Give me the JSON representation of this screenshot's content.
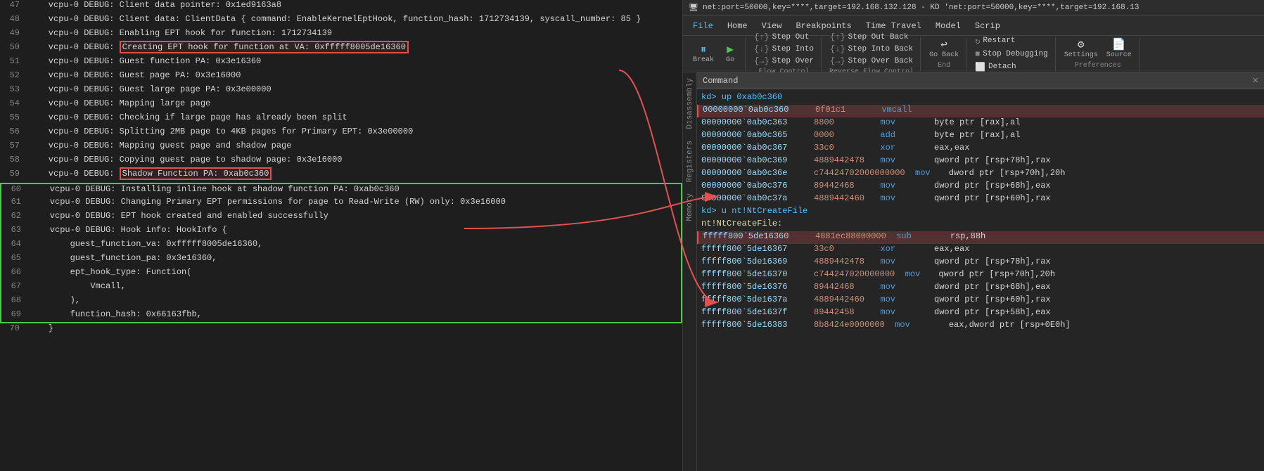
{
  "title": "net:port=50000,key=****,target=192.168.132.128 - KD 'net:port=50000,key=****,target=192.168.13",
  "menu": {
    "items": [
      "File",
      "Home",
      "View",
      "Breakpoints",
      "Time Travel",
      "Model",
      "Scrip"
    ]
  },
  "toolbar": {
    "break_label": "Break",
    "go_label": "Go",
    "step_out_label": "Step Out",
    "step_into_label": "Step Into",
    "step_over_label": "Step Over",
    "step_out_back_label": "Step Out Back",
    "step_into_back_label": "Step Into Back",
    "step_over_back_label": "Step Over Back",
    "go_back_label": "Go Back",
    "restart_label": "Restart",
    "stop_label": "Stop Debugging",
    "detach_label": "Detach",
    "settings_label": "Settings",
    "source_label": "Source",
    "flow_control": "Flow Control",
    "reverse_flow": "Reverse Flow Control",
    "end": "End",
    "preferences": "Preferences"
  },
  "side_tabs": [
    "Disassembly",
    "Registers",
    "Memory"
  ],
  "command_panel": {
    "title": "Command",
    "lines": [
      {
        "type": "prompt",
        "text": "kd> up 0xab0c360"
      },
      {
        "type": "asm",
        "addr": "00000000`0ab0c360",
        "bytes": "0f01c1",
        "instr": "vmcall",
        "operand": "",
        "highlight": "red"
      },
      {
        "type": "asm",
        "addr": "00000000`0ab0c363",
        "bytes": "8800",
        "instr": "mov",
        "operand": "     byte ptr [rax],al"
      },
      {
        "type": "asm",
        "addr": "00000000`0ab0c365",
        "bytes": "0000",
        "instr": "add",
        "operand": "     byte ptr [rax],al"
      },
      {
        "type": "asm",
        "addr": "00000000`0ab0c367",
        "bytes": "33c0",
        "instr": "xor",
        "operand": "     eax,eax"
      },
      {
        "type": "asm",
        "addr": "00000000`0ab0c369",
        "bytes": "4889442478",
        "instr": "mov",
        "operand": "     qword ptr [rsp+78h],rax"
      },
      {
        "type": "asm",
        "addr": "00000000`0ab0c36e",
        "bytes": "c74424702000000000",
        "instr": "mov",
        "operand": " dword ptr [rsp+70h],20h"
      },
      {
        "type": "asm",
        "addr": "00000000`0ab0c376",
        "bytes": "89442468",
        "instr": "mov",
        "operand": "     dword ptr [rsp+68h],eax"
      },
      {
        "type": "asm",
        "addr": "00000000`0ab0c37a",
        "bytes": "4889442460",
        "instr": "mov",
        "operand": "     qword ptr [rsp+60h],rax"
      },
      {
        "type": "prompt",
        "text": "kd> u nt!NtCreateFile"
      },
      {
        "type": "label",
        "text": "nt!NtCreateFile:"
      },
      {
        "type": "asm",
        "addr": "fffff800`5de16360",
        "bytes": "4881ec88000000",
        "instr": "sub",
        "operand": "     rsp,88h",
        "highlight": "red"
      },
      {
        "type": "asm",
        "addr": "fffff800`5de16367",
        "bytes": "33c0",
        "instr": "xor",
        "operand": "     eax,eax"
      },
      {
        "type": "asm",
        "addr": "fffff800`5de16369",
        "bytes": "4889442478",
        "instr": "mov",
        "operand": "     qword ptr [rsp+78h],rax"
      },
      {
        "type": "asm",
        "addr": "fffff800`5de16370",
        "bytes": "c744247020000000",
        "instr": "mov",
        "operand": " qword ptr [rsp+70h],20h"
      },
      {
        "type": "asm",
        "addr": "fffff800`5de16376",
        "bytes": "89442468",
        "instr": "mov",
        "operand": "     dword ptr [rsp+68h],eax"
      },
      {
        "type": "asm",
        "addr": "fffff800`5de1637a",
        "bytes": "4889442460",
        "instr": "mov",
        "operand": "     qword ptr [rsp+60h],rax"
      },
      {
        "type": "asm",
        "addr": "fffff800`5de1637f",
        "bytes": "89442458",
        "instr": "mov",
        "operand": "     dword ptr [rsp+58h],eax"
      },
      {
        "type": "asm",
        "addr": "fffff800`5de16383",
        "bytes": "8b8424e0000000",
        "instr": "mov",
        "operand": "     eax,dword ptr [rsp+0E0h]"
      }
    ]
  },
  "code_lines": [
    {
      "num": 47,
      "text": "    vcpu-0 DEBUG: Client data pointer: 0x1ed9163a8"
    },
    {
      "num": 48,
      "text": "    vcpu-0 DEBUG: Client data: ClientData { command: EnableKernelEptHook, function_hash: 1712734139, syscall_number: 85 }"
    },
    {
      "num": 49,
      "text": "    vcpu-0 DEBUG: Enabling EPT hook for function: 1712734139"
    },
    {
      "num": 50,
      "text": "    vcpu-0 DEBUG: Creating EPT hook for function at VA: 0xfffff8005de16360",
      "highlight_inline": "Creating EPT hook for function at VA: 0xfffff8005de16360"
    },
    {
      "num": 51,
      "text": "    vcpu-0 DEBUG: Guest function PA: 0x3e16360"
    },
    {
      "num": 52,
      "text": "    vcpu-0 DEBUG: Guest page PA: 0x3e16000"
    },
    {
      "num": 53,
      "text": "    vcpu-0 DEBUG: Guest large page PA: 0x3e00000"
    },
    {
      "num": 54,
      "text": "    vcpu-0 DEBUG: Mapping large page"
    },
    {
      "num": 55,
      "text": "    vcpu-0 DEBUG: Checking if large page has already been split"
    },
    {
      "num": 56,
      "text": "    vcpu-0 DEBUG: Splitting 2MB page to 4KB pages for Primary EPT: 0x3e00000"
    },
    {
      "num": 57,
      "text": "    vcpu-0 DEBUG: Mapping guest page and shadow page"
    },
    {
      "num": 58,
      "text": "    vcpu-0 DEBUG: Copying guest page to shadow page: 0x3e16000"
    },
    {
      "num": 59,
      "text": "    vcpu-0 DEBUG: Shadow Function PA: 0xab0c360",
      "highlight_inline": "Shadow Function PA: 0xab0c360"
    },
    {
      "num": 60,
      "text": "    vcpu-0 DEBUG: Installing inline hook at shadow function PA: 0xab0c360",
      "green_start": true
    },
    {
      "num": 61,
      "text": "    vcpu-0 DEBUG: Changing Primary EPT permissions for page to Read-Write (RW) only: 0x3e16000"
    },
    {
      "num": 62,
      "text": "    vcpu-0 DEBUG: EPT hook created and enabled successfully"
    },
    {
      "num": 63,
      "text": "    vcpu-0 DEBUG: Hook info: HookInfo {"
    },
    {
      "num": 64,
      "text": "        guest_function_va: 0xfffff8005de16360,"
    },
    {
      "num": 65,
      "text": "        guest_function_pa: 0x3e16360,"
    },
    {
      "num": 66,
      "text": "        ept_hook_type: Function("
    },
    {
      "num": 67,
      "text": "            Vmcall,"
    },
    {
      "num": 68,
      "text": "        ),"
    },
    {
      "num": 69,
      "text": "        function_hash: 0x66163fbb,",
      "green_end": true
    },
    {
      "num": 70,
      "text": "    }"
    }
  ]
}
